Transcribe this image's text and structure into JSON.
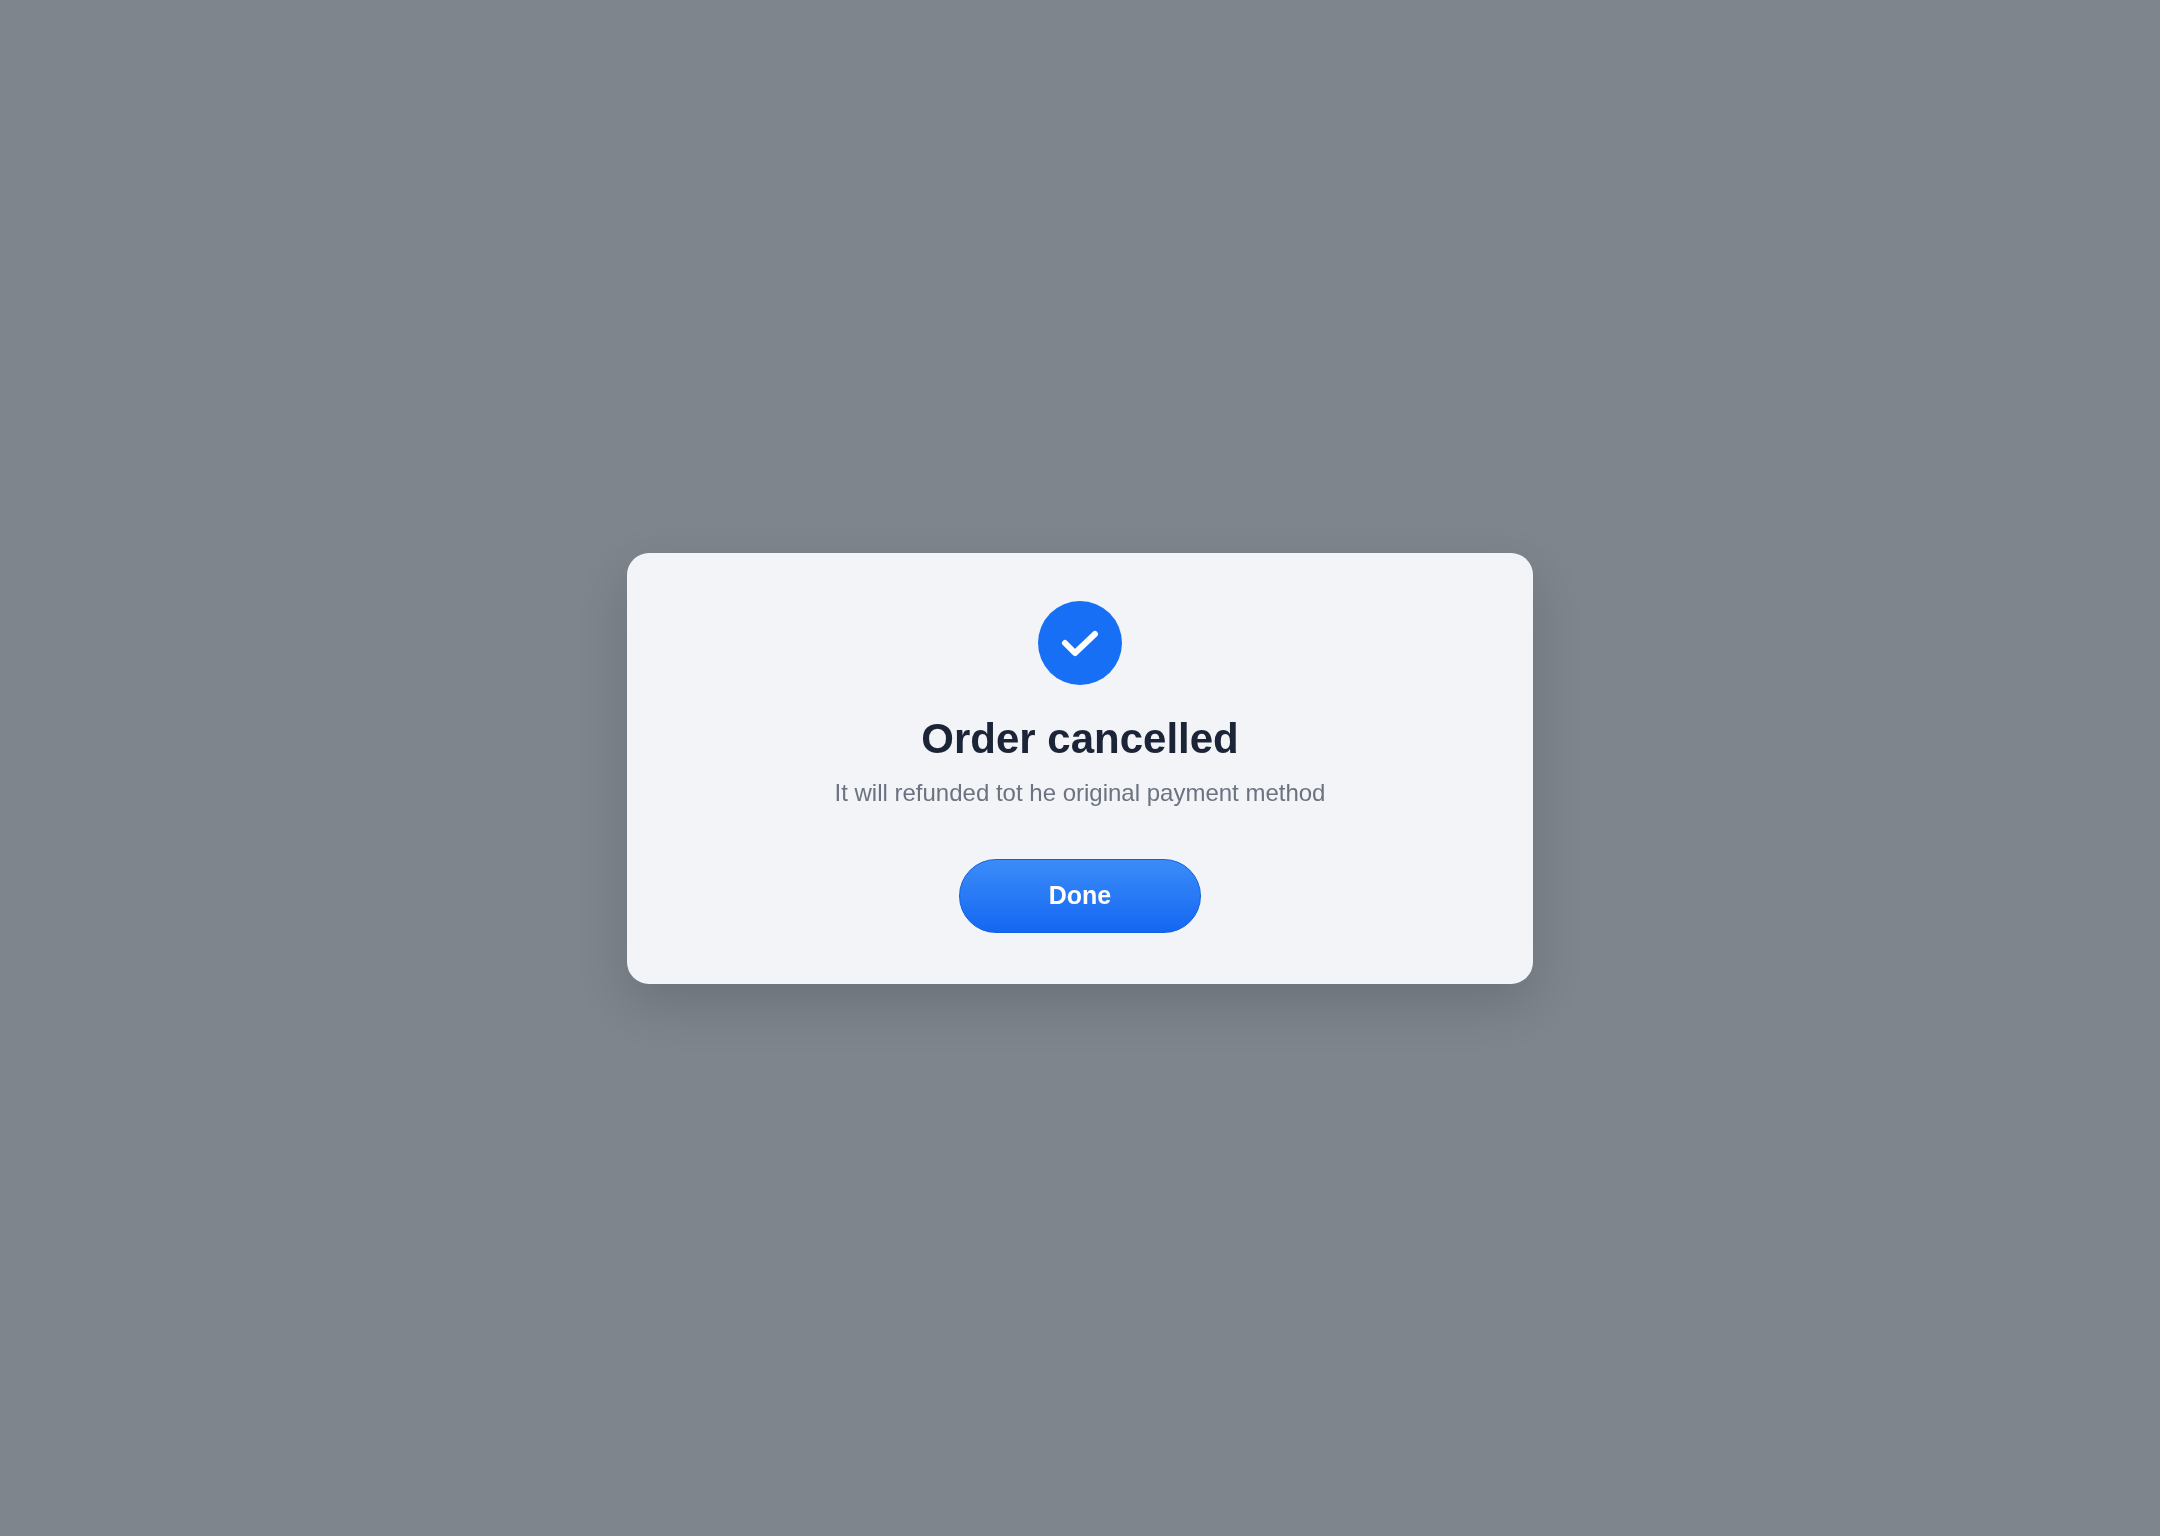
{
  "dialog": {
    "title": "Order cancelled",
    "message": "It will refunded tot he original payment method",
    "buttons": [
      "Done"
    ]
  }
}
